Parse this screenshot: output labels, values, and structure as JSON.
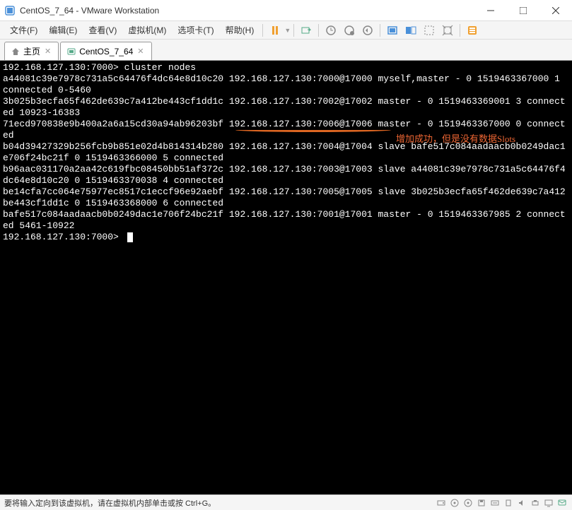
{
  "window": {
    "title": "CentOS_7_64 - VMware Workstation"
  },
  "menu": {
    "file": "文件(F)",
    "edit": "编辑(E)",
    "view": "查看(V)",
    "vm": "虚拟机(M)",
    "tabs": "选项卡(T)",
    "help": "帮助(H)"
  },
  "tabs": {
    "home": "主页",
    "vm": "CentOS_7_64"
  },
  "terminal": {
    "lines": "192.168.127.130:7000> cluster nodes\na44081c39e7978c731a5c64476f4dc64e8d10c20 192.168.127.130:7000@17000 myself,master - 0 1519463367000 1 connected 0-5460\n3b025b3ecfa65f462de639c7a412be443cf1dd1c 192.168.127.130:7002@17002 master - 0 1519463369001 3 connected 10923-16383\n71ecd970838e9b400a2a6a15cd30a94ab96203bf 192.168.127.130:7006@17006 master - 0 1519463367000 0 connected\nb04d39427329b256fcb9b851e02d4b814314b280 192.168.127.130:7004@17004 slave bafe517c084aadaacb0b0249dac1e706f24bc21f 0 1519463366000 5 connected\nb96aac031170a2aa42c619fbc08450bb51af372c 192.168.127.130:7003@17003 slave a44081c39e7978c731a5c64476f4dc64e8d10c20 0 1519463370038 4 connected\nbe14cfa7cc064e75977ec8517c1eccf96e92aebf 192.168.127.130:7005@17005 slave 3b025b3ecfa65f462de639c7a412be443cf1dd1c 0 1519463368000 6 connected\nbafe517c084aadaacb0b0249dac1e706f24bc21f 192.168.127.130:7001@17001 master - 0 1519463367985 2 connected 5461-10922\n192.168.127.130:7000> ",
    "annotation": "增加成功，但是没有数据Slots"
  },
  "statusbar": {
    "text": "要将输入定向到该虚拟机，请在虚拟机内部单击或按 Ctrl+G。"
  }
}
